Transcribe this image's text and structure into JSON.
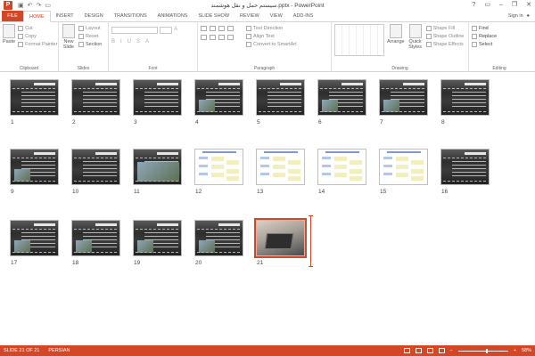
{
  "titlebar": {
    "title": "سیستم حمل و نقل هوشمند.pptx - PowerPoint",
    "app_icon": "P",
    "qat": [
      "save-icon",
      "undo-icon",
      "redo-icon",
      "present-icon"
    ],
    "qat_glyphs": [
      "▣",
      "↶",
      "↷",
      "▭"
    ],
    "window_buttons": [
      "?",
      "▭",
      "–",
      "❐",
      "✕"
    ]
  },
  "tabs": {
    "items": [
      "FILE",
      "HOME",
      "INSERT",
      "DESIGN",
      "TRANSITIONS",
      "ANIMATIONS",
      "SLIDE SHOW",
      "REVIEW",
      "VIEW",
      "ADD-INS"
    ],
    "active": "HOME",
    "sign_in": "Sign in"
  },
  "ribbon": {
    "clipboard": {
      "label": "Clipboard",
      "paste": "Paste",
      "cut": "Cut",
      "copy": "Copy",
      "format_painter": "Format Painter"
    },
    "slides": {
      "label": "Slides",
      "new_slide": "New Slide",
      "layout": "Layout",
      "reset": "Reset",
      "section": "Section"
    },
    "font": {
      "label": "Font",
      "size": "A"
    },
    "paragraph": {
      "label": "Paragraph",
      "text_direction": "Text Direction",
      "align_text": "Align Text",
      "convert": "Convert to SmartArt"
    },
    "drawing": {
      "label": "Drawing",
      "arrange": "Arrange",
      "quick_styles": "Quick Styles",
      "shape_fill": "Shape Fill",
      "shape_outline": "Shape Outline",
      "shape_effects": "Shape Effects"
    },
    "editing": {
      "label": "Editing",
      "find": "Find",
      "replace": "Replace",
      "select": "Select"
    }
  },
  "slides": [
    {
      "n": "1",
      "kind": "dark"
    },
    {
      "n": "2",
      "kind": "dark"
    },
    {
      "n": "3",
      "kind": "dark"
    },
    {
      "n": "4",
      "kind": "dark"
    },
    {
      "n": "5",
      "kind": "dark"
    },
    {
      "n": "6",
      "kind": "dark"
    },
    {
      "n": "7",
      "kind": "dark"
    },
    {
      "n": "8",
      "kind": "dark"
    },
    {
      "n": "9",
      "kind": "dark"
    },
    {
      "n": "10",
      "kind": "dark"
    },
    {
      "n": "11",
      "kind": "dark"
    },
    {
      "n": "12",
      "kind": "white"
    },
    {
      "n": "13",
      "kind": "white"
    },
    {
      "n": "14",
      "kind": "white"
    },
    {
      "n": "15",
      "kind": "white"
    },
    {
      "n": "16",
      "kind": "dark"
    },
    {
      "n": "17",
      "kind": "dark"
    },
    {
      "n": "18",
      "kind": "dark"
    },
    {
      "n": "19",
      "kind": "dark"
    },
    {
      "n": "20",
      "kind": "dark"
    },
    {
      "n": "21",
      "kind": "laptop"
    }
  ],
  "statusbar": {
    "slide_info": "SLIDE 21 OF 21",
    "language": "PERSIAN",
    "zoom": "58%",
    "zoom_minus": "−",
    "zoom_plus": "+",
    "zoom_fraction": 0.58
  },
  "colors": {
    "accent": "#d24726"
  }
}
